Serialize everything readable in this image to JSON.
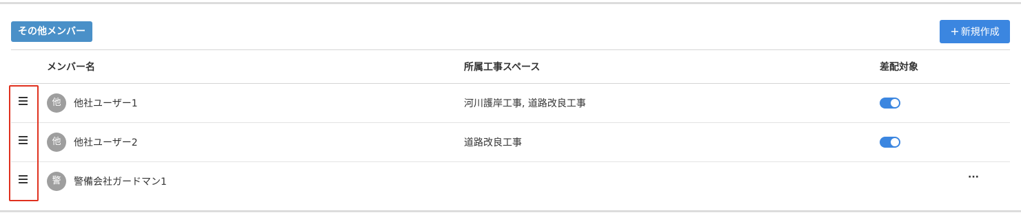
{
  "section": {
    "title": "その他メンバー",
    "new_button_icon": "plus-icon",
    "new_button_label": "新規作成"
  },
  "table": {
    "columns": [
      "メンバー名",
      "所属工事スペース",
      "差配対象"
    ],
    "rows": [
      {
        "avatar": "他",
        "name": "他社ユーザー1",
        "workspace": "河川護岸工事, 道路改良工事",
        "assignable": true
      },
      {
        "avatar": "他",
        "name": "他社ユーザー2",
        "workspace": "道路改良工事",
        "assignable": true
      },
      {
        "avatar": "警",
        "name": "警備会社ガードマン1",
        "workspace": "",
        "assignable": false,
        "more_label": "···"
      }
    ]
  },
  "colors": {
    "badge": "#4a90c8",
    "primary_button": "#3b86e0",
    "toggle_on": "#3b86e0",
    "avatar_bg": "#9e9e9e",
    "highlight": "#e0301e"
  },
  "icons": {
    "drag_handle": "drag-handle-icon",
    "more": "more-horizontal-icon"
  }
}
